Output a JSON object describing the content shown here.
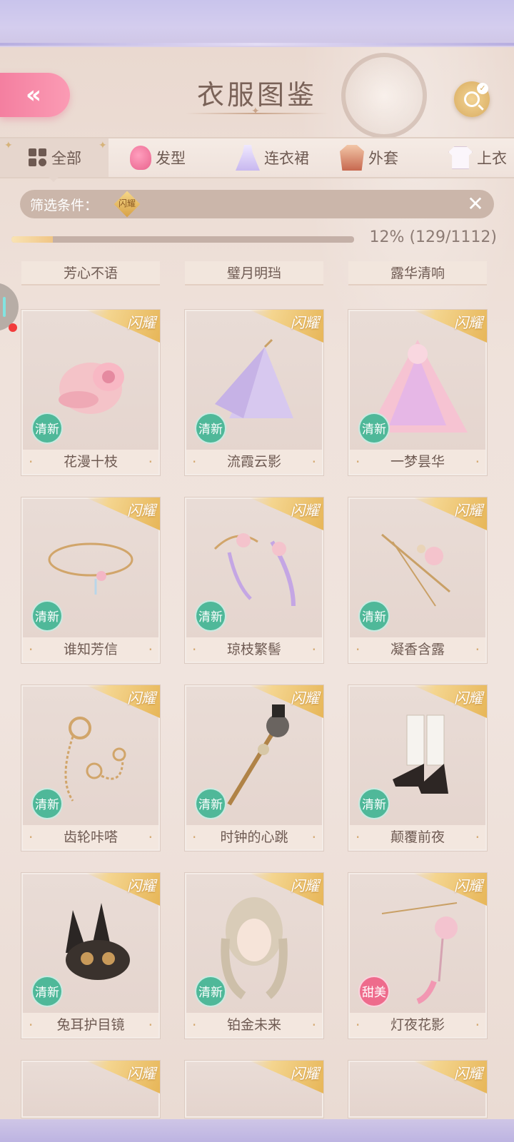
{
  "header": {
    "title": "衣服图鉴",
    "back_label": "«"
  },
  "tabs": [
    {
      "label": "全部",
      "icon": "grid-icon",
      "active": true
    },
    {
      "label": "发型",
      "icon": "hair-icon",
      "active": false
    },
    {
      "label": "连衣裙",
      "icon": "dress-icon",
      "active": false
    },
    {
      "label": "外套",
      "icon": "coat-icon",
      "active": false
    },
    {
      "label": "上衣",
      "icon": "top-icon",
      "active": false
    }
  ],
  "filter": {
    "label": "筛选条件：",
    "chip": "闪耀",
    "clear": "✕"
  },
  "progress": {
    "percent": 12,
    "text": "12% (129/1112)"
  },
  "top_names": [
    "芳心不语",
    "璧月明珰",
    "露华清响"
  ],
  "ribbon_label": "闪耀",
  "items": [
    {
      "name": "花漫十枝",
      "tag": "清新",
      "tag_type": "fresh",
      "art": "hat"
    },
    {
      "name": "流霞云影",
      "tag": "清新",
      "tag_type": "fresh",
      "art": "skirt"
    },
    {
      "name": "一梦昙华",
      "tag": "清新",
      "tag_type": "fresh",
      "art": "gown"
    },
    {
      "name": "谁知芳信",
      "tag": "清新",
      "tag_type": "fresh",
      "art": "necklace"
    },
    {
      "name": "琼枝繁髻",
      "tag": "清新",
      "tag_type": "fresh",
      "art": "hairpin-pair"
    },
    {
      "name": "凝香含露",
      "tag": "清新",
      "tag_type": "fresh",
      "art": "hairpin"
    },
    {
      "name": "齿轮咔嗒",
      "tag": "清新",
      "tag_type": "fresh",
      "art": "gear-chain"
    },
    {
      "name": "时钟的心跳",
      "tag": "清新",
      "tag_type": "fresh",
      "art": "cane"
    },
    {
      "name": "颠覆前夜",
      "tag": "清新",
      "tag_type": "fresh",
      "art": "boots"
    },
    {
      "name": "兔耳护目镜",
      "tag": "清新",
      "tag_type": "fresh",
      "art": "rabbit-mask"
    },
    {
      "name": "铂金未来",
      "tag": "清新",
      "tag_type": "fresh",
      "art": "hair-head"
    },
    {
      "name": "灯夜花影",
      "tag": "甜美",
      "tag_type": "sweet",
      "art": "lotus-pin"
    }
  ],
  "colors": {
    "accent_pink": "#f47fa0",
    "fresh_badge": "#4fb899",
    "sweet_badge": "#ee6b8c",
    "gold": "#e7b658"
  }
}
